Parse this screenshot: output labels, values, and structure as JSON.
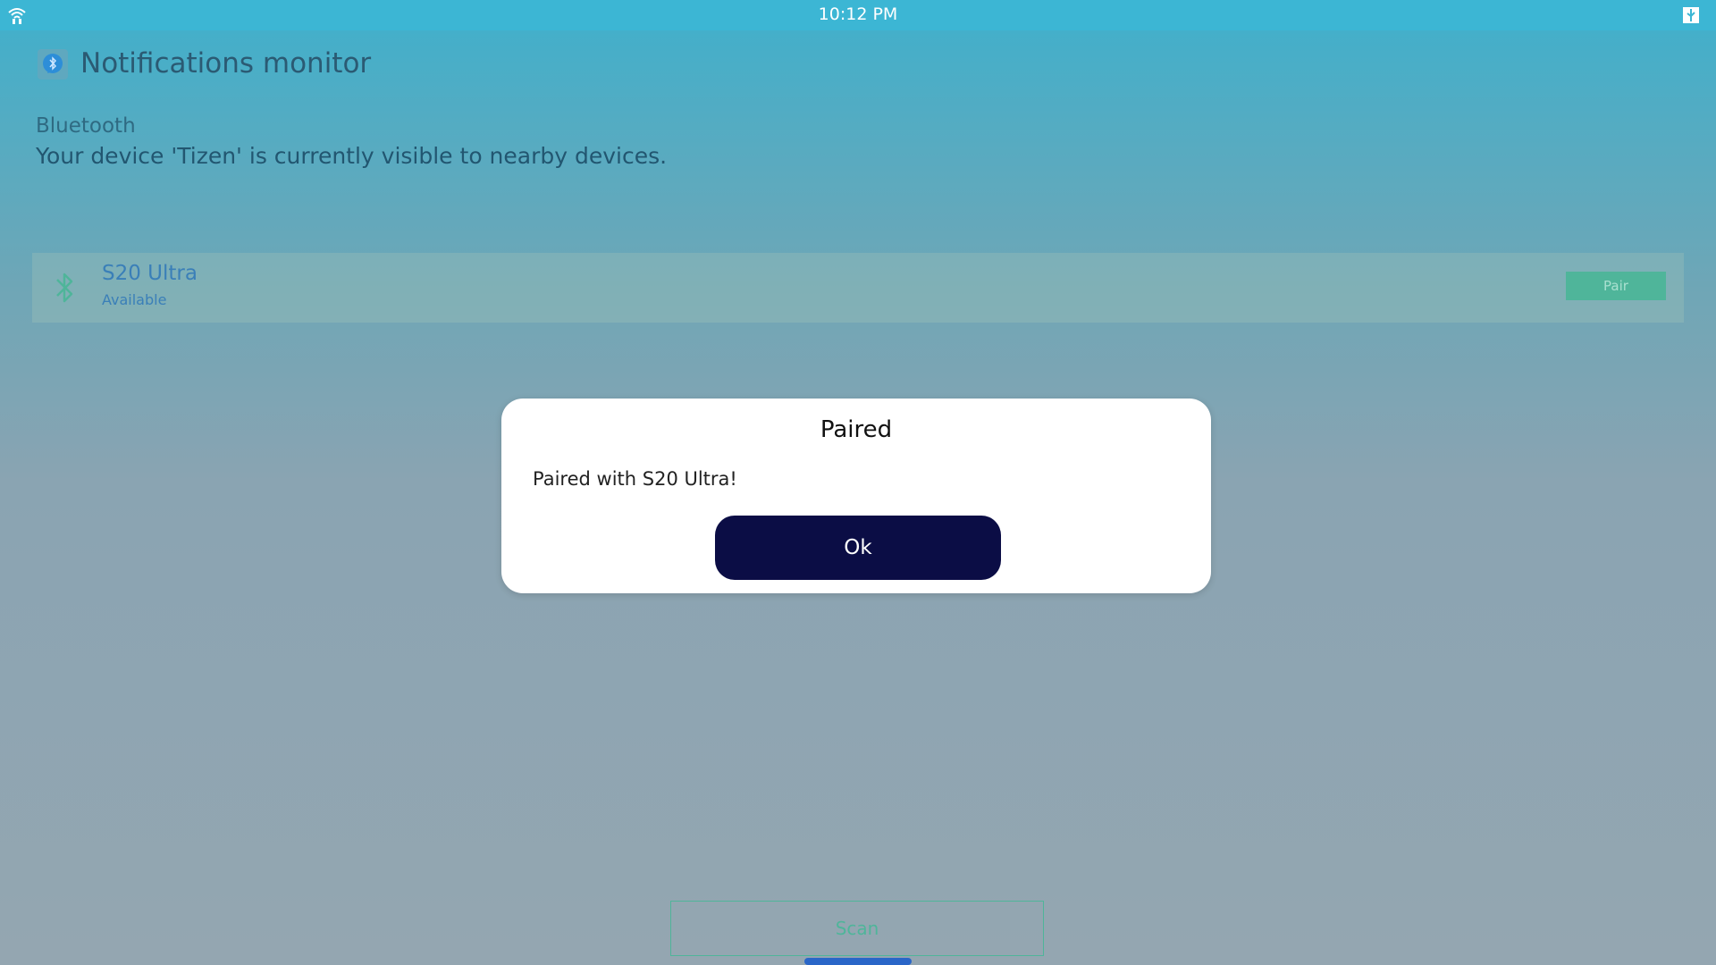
{
  "status_bar": {
    "time": "10:12 PM",
    "left_icon": "wifi-icon",
    "right_icon": "usb-icon"
  },
  "app": {
    "title": "Notifications monitor",
    "icon": "bluetooth-chat-icon"
  },
  "bluetooth": {
    "label": "Bluetooth",
    "description": "Your device 'Tizen' is currently visible to nearby devices."
  },
  "devices": [
    {
      "name": "S20 Ultra",
      "status": "Available",
      "icon": "bluetooth-icon",
      "action_label": "Pair"
    }
  ],
  "scan": {
    "label": "Scan"
  },
  "dialog": {
    "title": "Paired",
    "message": "Paired with S20 Ultra!",
    "ok_label": "Ok"
  },
  "colors": {
    "status_bar": "#3cb6d4",
    "accent_green": "#4fb59a",
    "device_text": "#3a7fb8",
    "dialog_button": "#0b0d45"
  }
}
